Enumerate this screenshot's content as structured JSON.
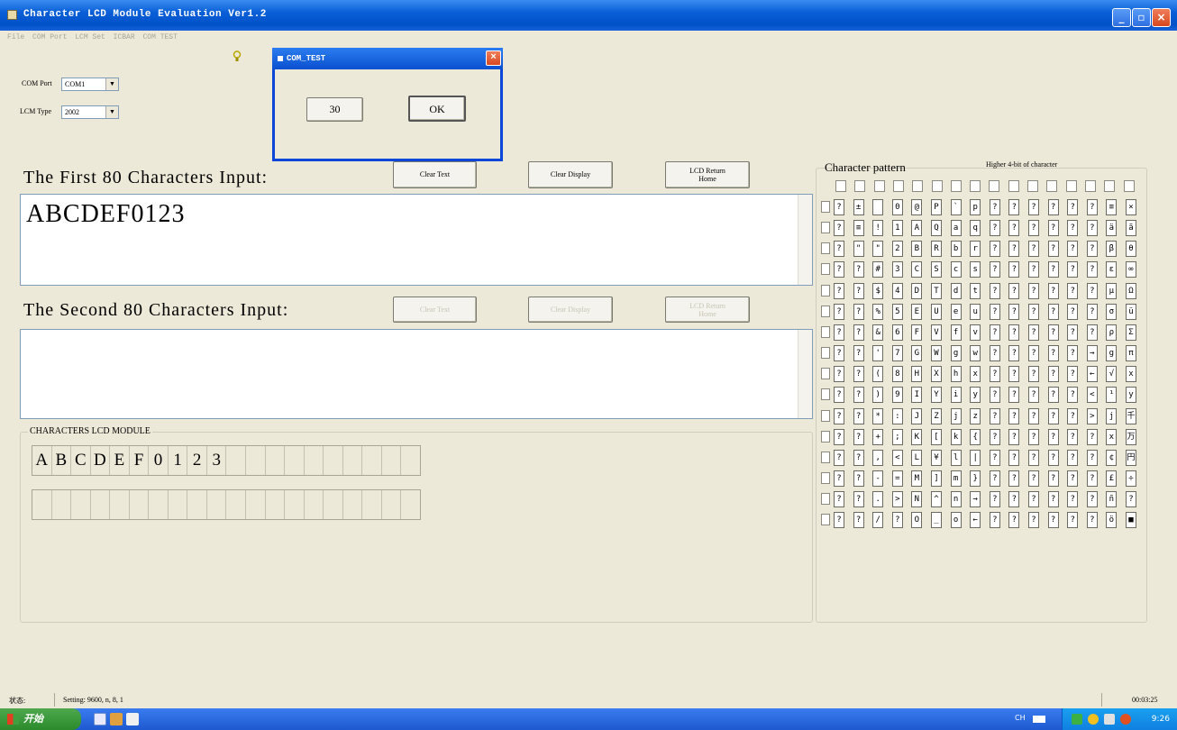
{
  "window": {
    "title": "Character LCD Module Evaluation Ver1.2",
    "min_label": "_",
    "max_label": "▫",
    "close_label": "×"
  },
  "menu": [
    "File",
    "COM Port",
    "LCM Set",
    "ICBAR",
    "COM TEST"
  ],
  "com_port": {
    "label": "COM Port",
    "value": "COM1",
    "arrow": "▼"
  },
  "lcm_type": {
    "label": "LCM Type",
    "value": "2002",
    "arrow": "▼"
  },
  "dialog": {
    "title": "COM_TEST",
    "close_label": "×",
    "value_button": "30",
    "ok_button": "OK"
  },
  "first_input": {
    "label": "The First 80 Characters Input:",
    "text": "ABCDEF0123",
    "clear_text": "Clear Text",
    "clear_display": "Clear Display",
    "return_home_l1": "LCD Return",
    "return_home_l2": "Home"
  },
  "second_input": {
    "label": "The Second 80 Characters Input:",
    "text": "",
    "clear_text": "Clear Text",
    "clear_display": "Clear Display",
    "return_home_l1": "LCD Return",
    "return_home_l2": "Home"
  },
  "lcd_module": {
    "title": "CHARACTERS LCD MODULE",
    "row1": [
      "A",
      "B",
      "C",
      "D",
      "E",
      "F",
      "0",
      "1",
      "2",
      "3",
      "",
      "",
      "",
      "",
      "",
      "",
      "",
      "",
      "",
      ""
    ],
    "row2": [
      "",
      "",
      "",
      "",
      "",
      "",
      "",
      "",
      "",
      "",
      "",
      "",
      "",
      "",
      "",
      "",
      "",
      "",
      "",
      ""
    ]
  },
  "character_pattern": {
    "title": "Character pattern",
    "subtitle": "Higher 4-bit of character",
    "rows": [
      [
        "?",
        "±",
        "",
        "0",
        "@",
        "P",
        "`",
        "p",
        "?",
        "?",
        "?",
        "?",
        "?",
        "?",
        "≡",
        "×"
      ],
      [
        "?",
        "≡",
        "!",
        "1",
        "A",
        "Q",
        "a",
        "q",
        "?",
        "?",
        "?",
        "?",
        "?",
        "?",
        "ä",
        "ã"
      ],
      [
        "?",
        "\"",
        "\"",
        "2",
        "B",
        "R",
        "b",
        "r",
        "?",
        "?",
        "?",
        "?",
        "?",
        "?",
        "β",
        "θ"
      ],
      [
        "?",
        "?",
        "#",
        "3",
        "C",
        "S",
        "c",
        "s",
        "?",
        "?",
        "?",
        "?",
        "?",
        "?",
        "ε",
        "∞"
      ],
      [
        "?",
        "?",
        "$",
        "4",
        "D",
        "T",
        "d",
        "t",
        "?",
        "?",
        "?",
        "?",
        "?",
        "?",
        "μ",
        "Ω"
      ],
      [
        "?",
        "?",
        "%",
        "5",
        "E",
        "U",
        "e",
        "u",
        "?",
        "?",
        "?",
        "?",
        "?",
        "?",
        "σ",
        "ü"
      ],
      [
        "?",
        "?",
        "&",
        "6",
        "F",
        "V",
        "f",
        "v",
        "?",
        "?",
        "?",
        "?",
        "?",
        "?",
        "ρ",
        "Σ"
      ],
      [
        "?",
        "?",
        "'",
        "7",
        "G",
        "W",
        "g",
        "w",
        "?",
        "?",
        "?",
        "?",
        "?",
        "→",
        "g",
        "π"
      ],
      [
        "?",
        "?",
        "(",
        "8",
        "H",
        "X",
        "h",
        "x",
        "?",
        "?",
        "?",
        "?",
        "?",
        "←",
        "√",
        "x"
      ],
      [
        "?",
        "?",
        ")",
        "9",
        "I",
        "Y",
        "i",
        "y",
        "?",
        "?",
        "?",
        "?",
        "?",
        "<",
        "¹",
        "y"
      ],
      [
        "?",
        "?",
        "*",
        ":",
        "J",
        "Z",
        "j",
        "z",
        "?",
        "?",
        "?",
        "?",
        "?",
        ">",
        "j",
        "千"
      ],
      [
        "?",
        "?",
        "+",
        ";",
        "K",
        "[",
        "k",
        "{",
        "?",
        "?",
        "?",
        "?",
        "?",
        "?",
        "x",
        "万"
      ],
      [
        "?",
        "?",
        ",",
        "<",
        "L",
        "¥",
        "l",
        "|",
        "?",
        "?",
        "?",
        "?",
        "?",
        "?",
        "¢",
        "円"
      ],
      [
        "?",
        "?",
        "-",
        "=",
        "M",
        "]",
        "m",
        "}",
        "?",
        "?",
        "?",
        "?",
        "?",
        "?",
        "£",
        "÷"
      ],
      [
        "?",
        "?",
        ".",
        ">",
        "N",
        "^",
        "n",
        "→",
        "?",
        "?",
        "?",
        "?",
        "?",
        "?",
        "ñ",
        "?"
      ],
      [
        "?",
        "?",
        "/",
        "?",
        "O",
        "_",
        "o",
        "←",
        "?",
        "?",
        "?",
        "?",
        "?",
        "?",
        "ö",
        "■"
      ]
    ]
  },
  "status": {
    "left": "状态:",
    "setting": "Setting: 9600, n, 8, 1",
    "time": "00:03:25"
  },
  "taskbar": {
    "start_label": "开始",
    "lang": "CH",
    "clock": "9:26"
  }
}
